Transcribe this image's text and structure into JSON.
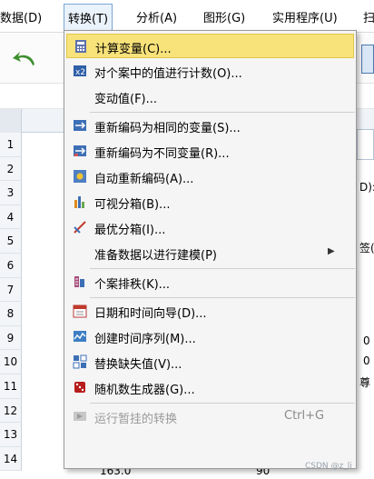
{
  "menubar": {
    "items": [
      {
        "label": "数据(D)"
      },
      {
        "label": "转换(T)"
      },
      {
        "label": "分析(A)"
      },
      {
        "label": "图形(G)"
      },
      {
        "label": "实用程序(U)"
      },
      {
        "label": "扫"
      }
    ]
  },
  "grid": {
    "rows": [
      "1",
      "2",
      "3",
      "4",
      "5",
      "6",
      "7",
      "8",
      "9",
      "10",
      "11",
      "12",
      "13",
      "14"
    ],
    "last_row_value": "163.0",
    "last_row_value2": "90",
    "right_fragments": {
      "a": "D):",
      "b": "签(",
      "c": "0",
      "d": "0",
      "e": "尊"
    }
  },
  "menu": {
    "items": [
      {
        "label": "计算变量(C)...",
        "icon": "calculator-icon",
        "highlighted": true
      },
      {
        "label": "对个案中的值进行计数(O)...",
        "icon": "count-values-icon"
      },
      {
        "label": "变动值(F)...",
        "icon": ""
      },
      {
        "label": "重新编码为相同的变量(S)...",
        "icon": "recode-same-icon"
      },
      {
        "label": "重新编码为不同变量(R)...",
        "icon": "recode-different-icon"
      },
      {
        "label": "自动重新编码(A)...",
        "icon": "auto-recode-icon"
      },
      {
        "label": "可视分箱(B)...",
        "icon": "visual-binning-icon"
      },
      {
        "label": "最优分箱(I)...",
        "icon": "optimal-binning-icon"
      },
      {
        "label": "准备数据以进行建模(P)",
        "icon": "",
        "submenu": true
      },
      {
        "label": "个案排秩(K)...",
        "icon": "rank-cases-icon"
      },
      {
        "label": "日期和时间向导(D)...",
        "icon": "calendar-icon"
      },
      {
        "label": "创建时间序列(M)...",
        "icon": "time-series-icon"
      },
      {
        "label": "替换缺失值(V)...",
        "icon": "replace-missing-icon"
      },
      {
        "label": "随机数生成器(G)...",
        "icon": "dice-icon"
      },
      {
        "label": "运行暂挂的转换",
        "icon": "run-pending-icon",
        "shortcut": "Ctrl+G",
        "disabled": true
      }
    ]
  },
  "watermark": "CSDN @z_li"
}
